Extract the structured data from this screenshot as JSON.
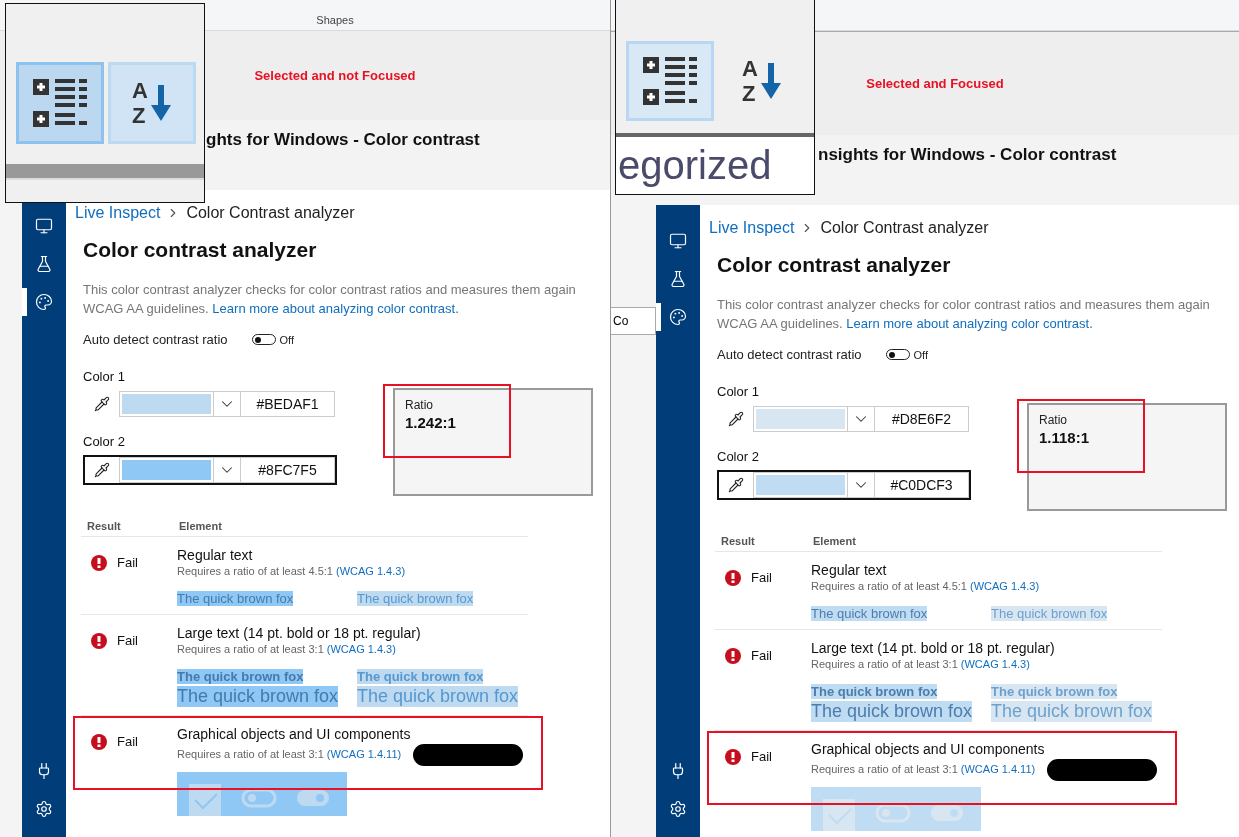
{
  "panels": [
    {
      "ribbon": {
        "group_label": "Shapes"
      },
      "caption": "Selected and not Focused",
      "inset": {
        "window_focused": false,
        "buttons": [
          {
            "kind": "categorized",
            "selected": true,
            "hovered": false
          },
          {
            "kind": "alphabetical",
            "selected": false,
            "hovered": true,
            "letters": [
              "A",
              "Z"
            ]
          }
        ]
      },
      "window_title": "ghts for Windows - Color contrast",
      "nav": [
        {
          "kind": "live-inspect",
          "selected": false
        },
        {
          "kind": "tests",
          "selected": false
        },
        {
          "kind": "color-contrast",
          "selected": true
        }
      ],
      "nav_bottom": [
        {
          "kind": "connect"
        },
        {
          "kind": "settings"
        }
      ],
      "breadcrumb": {
        "link": "Live Inspect",
        "current": "Color Contrast analyzer"
      },
      "heading": "Color contrast analyzer",
      "description": {
        "line_1": "This color contrast analyzer checks for color contrast ratios and measures them again",
        "line_2": "WCAG AA guidelines.",
        "link": "Learn more about analyzing color contrast."
      },
      "auto_detect": {
        "label": "Auto detect contrast ratio",
        "on": false,
        "state_text": "Off"
      },
      "colors": [
        {
          "label": "Color 1",
          "hex": "#BEDAF1",
          "focused": false
        },
        {
          "label": "Color 2",
          "hex": "#8FC7F5",
          "focused": true
        }
      ],
      "ratio": {
        "label": "Ratio",
        "value": "1.242:1"
      },
      "results": {
        "columns": [
          "Result",
          "Element"
        ],
        "rows": [
          {
            "kind": "regular",
            "result": "Fail",
            "title": "Regular text",
            "requirement": "Requires a ratio of at least 4.5:1",
            "link": "(WCAG 1.4.3)",
            "samples": [
              "The quick brown fox",
              "The quick brown fox"
            ],
            "highlighted": false
          },
          {
            "kind": "large",
            "result": "Fail",
            "title": "Large text (14 pt. bold or 18 pt. regular)",
            "requirement": "Requires a ratio of at least 3:1",
            "link": "(WCAG 1.4.3)",
            "samples": [
              "The quick brown fox",
              "The quick brown fox",
              "The quick brown fox",
              "The quick brown fox"
            ],
            "highlighted": false
          },
          {
            "kind": "graphical",
            "result": "Fail",
            "title": "Graphical objects and UI components",
            "requirement": "Requires a ratio of at least 3:1",
            "link": "(WCAG 1.4.11)",
            "samples": [],
            "highlighted": true
          }
        ]
      }
    },
    {
      "backdrop_text": "Co",
      "caption": "Selected and Focused",
      "inset": {
        "window_focused": true,
        "buttons": [
          {
            "kind": "categorized",
            "selected": true,
            "hovered": false
          },
          {
            "kind": "alphabetical",
            "selected": false,
            "hovered": false,
            "letters": [
              "A",
              "Z"
            ]
          }
        ],
        "label": "egorized"
      },
      "window_title": "nsights for Windows - Color contrast",
      "nav": [
        {
          "kind": "live-inspect",
          "selected": false
        },
        {
          "kind": "tests",
          "selected": false
        },
        {
          "kind": "color-contrast",
          "selected": true
        }
      ],
      "nav_bottom": [
        {
          "kind": "connect"
        },
        {
          "kind": "settings"
        }
      ],
      "breadcrumb": {
        "link": "Live Inspect",
        "current": "Color Contrast analyzer"
      },
      "heading": "Color contrast analyzer",
      "description": {
        "line_1": "This color contrast analyzer checks for color contrast ratios and measures them again",
        "line_2": "WCAG AA guidelines.",
        "link": "Learn more about analyzing color contrast."
      },
      "auto_detect": {
        "label": "Auto detect contrast ratio",
        "on": false,
        "state_text": "Off"
      },
      "colors": [
        {
          "label": "Color 1",
          "hex": "#D8E6F2",
          "focused": false
        },
        {
          "label": "Color 2",
          "hex": "#C0DCF3",
          "focused": true
        }
      ],
      "ratio": {
        "label": "Ratio",
        "value": "1.118:1"
      },
      "results": {
        "columns": [
          "Result",
          "Element"
        ],
        "rows": [
          {
            "kind": "regular",
            "result": "Fail",
            "title": "Regular text",
            "requirement": "Requires a ratio of at least 4.5:1",
            "link": "(WCAG 1.4.3)",
            "samples": [
              "The quick brown fox",
              "The quick brown fox"
            ],
            "highlighted": false
          },
          {
            "kind": "large",
            "result": "Fail",
            "title": "Large text (14 pt. bold or 18 pt. regular)",
            "requirement": "Requires a ratio of at least 3:1",
            "link": "(WCAG 1.4.3)",
            "samples": [
              "The quick brown fox",
              "The quick brown fox",
              "The quick brown fox",
              "The quick brown fox"
            ],
            "highlighted": false
          },
          {
            "kind": "graphical",
            "result": "Fail",
            "title": "Graphical objects and UI components",
            "requirement": "Requires a ratio of at least 3:1",
            "link": "(WCAG 1.4.11)",
            "samples": [],
            "highlighted": true
          }
        ]
      }
    }
  ]
}
